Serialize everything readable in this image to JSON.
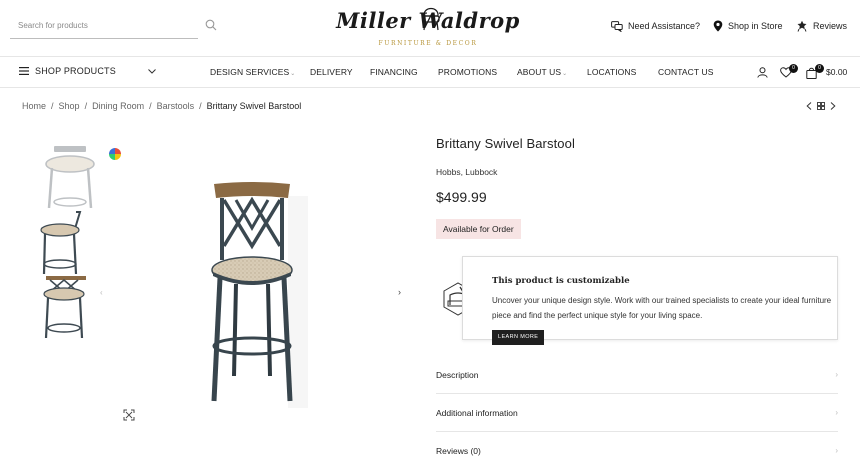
{
  "search": {
    "placeholder": "Search for products"
  },
  "logo": {
    "script": "Miller Waldrop",
    "tagline": "FURNITURE & DECOR"
  },
  "utilities": {
    "assistance": "Need Assistance?",
    "store": "Shop in Store",
    "reviews": "Reviews"
  },
  "nav": {
    "shop_products": "SHOP PRODUCTS",
    "items": [
      "DESIGN SERVICES",
      "DELIVERY",
      "FINANCING",
      "PROMOTIONS",
      "ABOUT US",
      "LOCATIONS",
      "CONTACT US"
    ],
    "wishlist_count": "0",
    "cart_count": "0",
    "cart_total": "$0.00"
  },
  "breadcrumb": [
    "Home",
    "Shop",
    "Dining Room",
    "Barstools",
    "Brittany Swivel Barstool"
  ],
  "product": {
    "title": "Brittany Swivel Barstool",
    "location": "Hobbs, Lubbock",
    "price": "$499.99",
    "availability": "Available for Order"
  },
  "customize": {
    "title": "This product is customizable",
    "text": "Uncover your unique design style. Work with our trained specialists to create your ideal furniture piece and find the perfect unique style for your living space.",
    "button": "LEARN MORE"
  },
  "accordion": [
    "Description",
    "Additional information",
    "Reviews (0)"
  ],
  "colors": {
    "accent_badge": "#f7e4e4",
    "dark": "#1f1f1f",
    "logo_gold": "#b8973d"
  }
}
